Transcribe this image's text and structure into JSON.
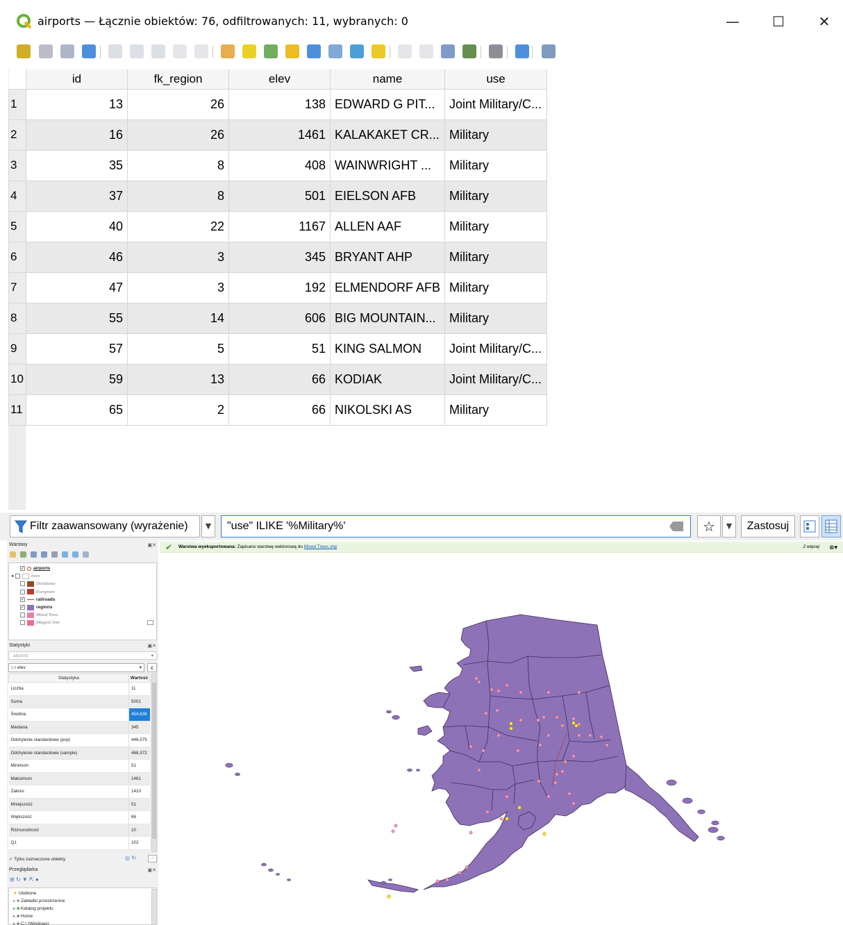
{
  "window": {
    "title": "airports — Łącznie obiektów: 76, odfiltrowanych: 11, wybranych: 0",
    "minimize_glyph": "—",
    "maximize_glyph": "☐",
    "close_glyph": "✕"
  },
  "toolbar": {
    "icons": [
      "toggle-editing-icon",
      "multi-edit-icon",
      "save-edits-icon",
      "reload-icon",
      "add-feature-icon",
      "delete-feature-icon",
      "cut-icon",
      "copy-icon",
      "paste-icon",
      "select-by-expression-icon",
      "select-all-icon",
      "invert-selection-icon",
      "deselect-icon",
      "filter-selected-icon",
      "move-selection-top-icon",
      "pan-to-selected-icon",
      "zoom-to-selected-icon",
      "new-field-icon",
      "delete-field-icon",
      "field-calculator-icon",
      "conditional-formatting-icon",
      "actions-icon",
      "dock-icon",
      "organize-columns-icon"
    ]
  },
  "table": {
    "columns": [
      "id",
      "fk_region",
      "elev",
      "name",
      "use"
    ],
    "rows": [
      {
        "n": "1",
        "id": "13",
        "fk_region": "26",
        "elev": "138",
        "name": "EDWARD G PIT...",
        "use": "Joint Military/C..."
      },
      {
        "n": "2",
        "id": "16",
        "fk_region": "26",
        "elev": "1461",
        "name": "KALAKAKET CR...",
        "use": "Military"
      },
      {
        "n": "3",
        "id": "35",
        "fk_region": "8",
        "elev": "408",
        "name": "WAINWRIGHT ...",
        "use": "Military"
      },
      {
        "n": "4",
        "id": "37",
        "fk_region": "8",
        "elev": "501",
        "name": "EIELSON AFB",
        "use": "Military"
      },
      {
        "n": "5",
        "id": "40",
        "fk_region": "22",
        "elev": "1167",
        "name": "ALLEN AAF",
        "use": "Military"
      },
      {
        "n": "6",
        "id": "46",
        "fk_region": "3",
        "elev": "345",
        "name": "BRYANT AHP",
        "use": "Military"
      },
      {
        "n": "7",
        "id": "47",
        "fk_region": "3",
        "elev": "192",
        "name": "ELMENDORF AFB",
        "use": "Military"
      },
      {
        "n": "8",
        "id": "55",
        "fk_region": "14",
        "elev": "606",
        "name": "BIG MOUNTAIN...",
        "use": "Military"
      },
      {
        "n": "9",
        "id": "57",
        "fk_region": "5",
        "elev": "51",
        "name": "KING SALMON",
        "use": "Joint Military/C..."
      },
      {
        "n": "10",
        "id": "59",
        "fk_region": "13",
        "elev": "66",
        "name": "KODIAK",
        "use": "Joint Military/C..."
      },
      {
        "n": "11",
        "id": "65",
        "fk_region": "2",
        "elev": "66",
        "name": "NIKOLSKI AS",
        "use": "Military"
      }
    ]
  },
  "filter": {
    "mode_label": "Filtr zaawansowany (wyrażenie)",
    "expression": "\"use\" ILIKE '%Military%'",
    "apply_label": "Zastosuj"
  },
  "layers_panel": {
    "title": "Warstwy",
    "layers": [
      {
        "name": "airports",
        "checked": true,
        "style": "bold-underline",
        "color": "#e88aa0"
      },
      {
        "name": "trees",
        "checked": false,
        "style": "italic-group",
        "color": "#bbbbbb"
      },
      {
        "name": "Deciduous",
        "checked": false,
        "style": "italic",
        "color": "#8b4a2b"
      },
      {
        "name": "Evergreen",
        "checked": false,
        "style": "italic",
        "color": "#c0392b"
      },
      {
        "name": "railroads",
        "checked": true,
        "style": "bold",
        "color": "#b03a3a"
      },
      {
        "name": "regions",
        "checked": true,
        "style": "bold",
        "color": "#8e72b8"
      },
      {
        "name": "Mixed Trees",
        "checked": false,
        "style": "italic",
        "color": "#e580a8"
      },
      {
        "name": "Długość linii",
        "checked": false,
        "style": "italic",
        "color": "#e8708e"
      }
    ]
  },
  "stats_panel": {
    "title": "Statystyki",
    "layer": "airports",
    "field": "elev",
    "field_prefix": "1.2",
    "col_stat": "Statystyka",
    "col_value": "Wartość",
    "rows": [
      {
        "k": "Liczba",
        "v": "11"
      },
      {
        "k": "Suma",
        "v": "5001"
      },
      {
        "k": "Średnia",
        "v": "454,636",
        "selected": true
      },
      {
        "k": "Mediana",
        "v": "345"
      },
      {
        "k": "Odchylenie standardowe (pop)",
        "v": "446,575"
      },
      {
        "k": "Odchylenie standardowe (sample)",
        "v": "468,372"
      },
      {
        "k": "Minimum",
        "v": "51"
      },
      {
        "k": "Maksimum",
        "v": "1461"
      },
      {
        "k": "Zakres",
        "v": "1410"
      },
      {
        "k": "Mniejszość",
        "v": "51"
      },
      {
        "k": "Większość",
        "v": "66"
      },
      {
        "k": "Różnorodność",
        "v": "10"
      },
      {
        "k": "Q1",
        "v": "102"
      }
    ],
    "only_selected": "Tylko zaznaczone obiekty"
  },
  "browser_panel": {
    "title": "Przeglądarka",
    "items": [
      "Ulubione",
      "Zakładki przestrzenne",
      "Katalog projektu",
      "Home",
      "C:\\ (Windows)"
    ]
  },
  "message": {
    "bold": "Warstwa wyeksportowana:",
    "text": " Zapisano warstwę wektorową do ",
    "link": "Mixed Trees.shp",
    "more": "2 więcej"
  },
  "colors": {
    "region_fill": "#8e72b8",
    "region_stroke": "#3e2e58",
    "airport_point": "#f29bb0",
    "selected_point": "#f7e82a",
    "accent": "#1e7fd8"
  }
}
